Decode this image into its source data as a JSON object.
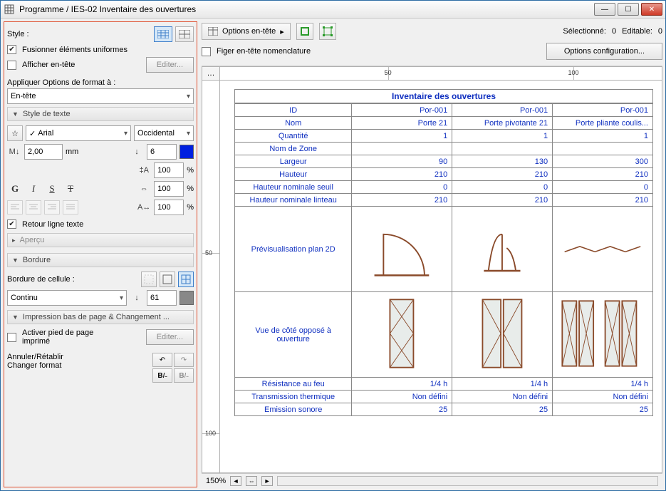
{
  "window": {
    "title": "Programme / IES-02 Inventaire des ouvertures"
  },
  "sidebar": {
    "style_label": "Style :",
    "merge_uniform": "Fusionner éléments uniformes",
    "show_header": "Afficher en-tête",
    "edit": "Editer...",
    "apply_format_label": "Appliquer Options de format à :",
    "apply_format_value": "En-tête",
    "section_textstyle": "Style de texte",
    "font": "Arial",
    "script": "Occidental",
    "size_value": "2,00",
    "size_unit": "mm",
    "leading_value": "6",
    "width_pct": "100",
    "width_unit": "%",
    "spacing_pct": "100",
    "spacing_unit": "%",
    "spacing2_pct": "100",
    "spacing2_unit": "%",
    "wrap_text": "Retour ligne texte",
    "section_preview": "Aperçu",
    "section_border": "Bordure",
    "cell_border_label": "Bordure de cellule :",
    "line_style": "Continu",
    "line_weight": "61",
    "section_footer": "Impression bas de page & Changement ...",
    "footer_enable": "Activer pied de page imprimé",
    "edit2": "Editer...",
    "undo_label": "Annuler/Rétablir",
    "format_label": "Changer format"
  },
  "toolbar": {
    "options_header": "Options en-tête",
    "freeze_header": "Figer en-tête nomenclature",
    "selected_label": "Sélectionné:",
    "selected_val": "0",
    "editable_label": "Editable:",
    "editable_val": "0",
    "config_button": "Options configuration..."
  },
  "ruler": {
    "h50": "50",
    "h100": "100",
    "v50": "50",
    "v100": "100"
  },
  "sheet": {
    "title": "Inventaire des ouvertures",
    "row_headers": [
      "ID",
      "Nom",
      "Quantité",
      "Nom de Zone",
      "Largeur",
      "Hauteur",
      "Hauteur nominale seuil",
      "Hauteur nominale linteau",
      "Prévisualisation plan 2D",
      "Vue de côté opposé à ouverture",
      "Résistance au feu",
      "Transmission thermique",
      "Emission sonore"
    ],
    "cols": [
      {
        "ID": "Por-001",
        "Nom": "Porte 21",
        "Quantité": "1",
        "Nom de Zone": "",
        "Largeur": "90",
        "Hauteur": "210",
        "Hauteur nominale seuil": "0",
        "Hauteur nominale linteau": "210",
        "Résistance au feu": "1/4 h",
        "Transmission thermique": "Non défini",
        "Emission sonore": "25"
      },
      {
        "ID": "Por-001",
        "Nom": "Porte pivotante 21",
        "Quantité": "1",
        "Nom de Zone": "",
        "Largeur": "130",
        "Hauteur": "210",
        "Hauteur nominale seuil": "0",
        "Hauteur nominale linteau": "210",
        "Résistance au feu": "1/4 h",
        "Transmission thermique": "Non défini",
        "Emission sonore": "25"
      },
      {
        "ID": "Por-001",
        "Nom": "Porte pliante coulis...",
        "Quantité": "1",
        "Nom de Zone": "",
        "Largeur": "300",
        "Hauteur": "210",
        "Hauteur nominale seuil": "0",
        "Hauteur nominale linteau": "210",
        "Résistance au feu": "1/4 h",
        "Transmission thermique": "Non défini",
        "Emission sonore": "25"
      }
    ]
  },
  "bottombar": {
    "zoom": "150%"
  }
}
